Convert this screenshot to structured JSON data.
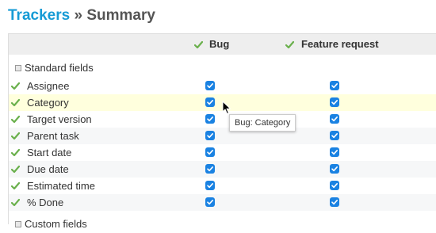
{
  "breadcrumb": {
    "link_label": "Trackers",
    "separator": "»",
    "current": "Summary"
  },
  "columns": [
    {
      "label": "Bug"
    },
    {
      "label": "Feature request"
    }
  ],
  "groups": {
    "standard": "Standard fields",
    "custom": "Custom fields"
  },
  "fields": [
    {
      "label": "Assignee",
      "bug": true,
      "feature": true
    },
    {
      "label": "Category",
      "bug": true,
      "feature": true
    },
    {
      "label": "Target version",
      "bug": true,
      "feature": true
    },
    {
      "label": "Parent task",
      "bug": true,
      "feature": true
    },
    {
      "label": "Start date",
      "bug": true,
      "feature": true
    },
    {
      "label": "Due date",
      "bug": true,
      "feature": true
    },
    {
      "label": "Estimated time",
      "bug": true,
      "feature": true
    },
    {
      "label": "% Done",
      "bug": true,
      "feature": true
    }
  ],
  "tooltip": "Bug: Category",
  "colors": {
    "link": "#169bd5",
    "checkbox": "#1a82e2",
    "check_icon": "#6ab04c",
    "highlight_row": "#ffffdd"
  }
}
